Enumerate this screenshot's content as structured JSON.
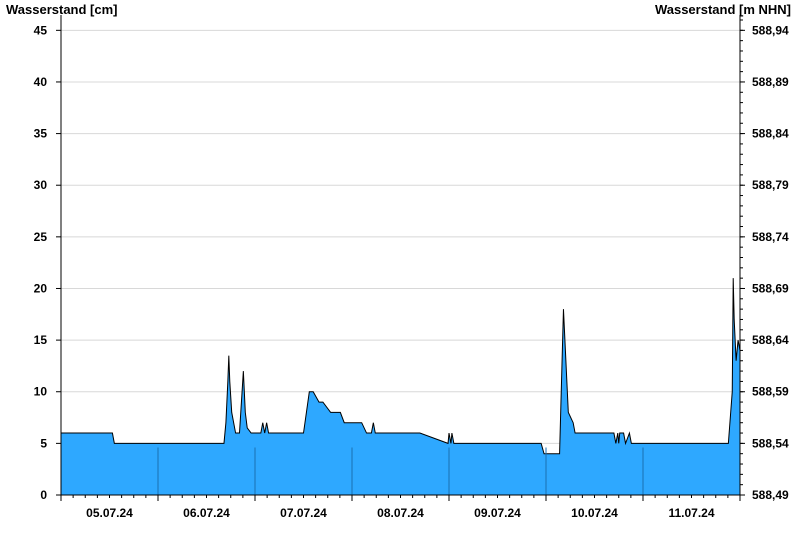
{
  "chart_data": {
    "type": "area",
    "left_axis_title": "Wasserstand [cm]",
    "right_axis_title": "Wasserstand [m NHN]",
    "ylim": [
      0,
      46
    ],
    "yticks": [
      0,
      5,
      10,
      15,
      20,
      25,
      30,
      35,
      40,
      45
    ],
    "right_yticks": [
      "588,49",
      "588,54",
      "588,59",
      "588,64",
      "588,69",
      "588,74",
      "588,79",
      "588,84",
      "588,89",
      "588,94"
    ],
    "xlim": [
      0,
      7
    ],
    "day_starts": [
      0,
      1,
      2,
      3,
      4,
      5,
      6
    ],
    "xtick_labels": [
      "05.07.24",
      "06.07.24",
      "07.07.24",
      "08.07.24",
      "09.07.24",
      "10.07.24",
      "11.07.24"
    ],
    "grid": true,
    "fill_color": "#2ea8ff",
    "line_color": "#000000",
    "grid_color": "#d8d8d8",
    "series": [
      {
        "x": [
          0,
          0.53,
          0.55,
          1.0,
          1.68,
          1.7,
          1.72,
          1.73,
          1.74,
          1.76,
          1.8,
          1.84,
          1.86,
          1.88,
          1.89,
          1.9,
          1.92,
          1.96,
          2.0,
          2.06,
          2.08,
          2.1,
          2.12,
          2.14,
          2.16,
          2.5,
          2.53,
          2.56,
          2.6,
          2.66,
          2.7,
          2.78,
          2.84,
          2.88,
          2.92,
          2.96,
          3.0,
          3.1,
          3.15,
          3.18,
          3.2,
          3.22,
          3.24,
          3.26,
          3.27,
          3.28,
          3.29,
          3.3,
          3.35,
          3.38,
          3.4,
          3.42,
          3.5,
          3.7,
          3.99,
          4.0,
          4.02,
          4.03,
          4.05,
          4.07,
          4.1,
          4.5,
          4.95,
          4.98,
          5.0,
          5.1,
          5.14,
          5.16,
          5.18,
          5.2,
          5.23,
          5.28,
          5.3,
          5.34,
          5.4,
          5.7,
          5.72,
          5.74,
          5.75,
          5.76,
          5.78,
          5.8,
          5.82,
          5.86,
          5.88,
          5.9,
          5.92,
          5.94,
          6.0,
          6.3,
          6.88,
          6.92,
          6.93,
          6.94,
          6.96,
          6.98,
          7.0
        ],
        "y": [
          6,
          6,
          5,
          5,
          5,
          7,
          11,
          13.5,
          11,
          8,
          6,
          6,
          9,
          12,
          10,
          8,
          6.5,
          6,
          6,
          6,
          7,
          6,
          7,
          6,
          6,
          6,
          8,
          10,
          10,
          9,
          9,
          8,
          8,
          8,
          7,
          7,
          7,
          7,
          6,
          6,
          6,
          7,
          6,
          6,
          6,
          6,
          6,
          6,
          6,
          6,
          6,
          6,
          6,
          6,
          5,
          6,
          5,
          6,
          5,
          5,
          5,
          5,
          5,
          4,
          4,
          4,
          4,
          11,
          18,
          14,
          8,
          7,
          6,
          6,
          6,
          6,
          5,
          6,
          5,
          6,
          6,
          6,
          5,
          6,
          5,
          5,
          5,
          5,
          5,
          5,
          5,
          10,
          21,
          17,
          13,
          15,
          14
        ]
      }
    ]
  }
}
